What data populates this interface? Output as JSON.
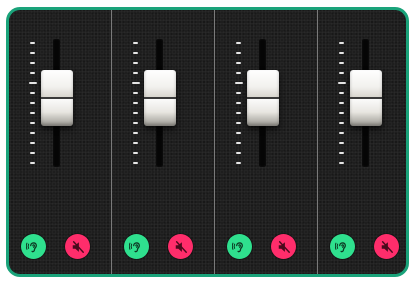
{
  "colors": {
    "frame_border": "#1aa37a",
    "panel_background": "#1e1e1e",
    "listen_button": "#2fe08e",
    "mute_button": "#ff2d6b",
    "tick_marks": "#e6e6e6"
  },
  "channels": [
    {
      "fader_level": 0.72,
      "listen_icon": "ear-icon",
      "mute_icon": "speaker-mute-icon"
    },
    {
      "fader_level": 0.72,
      "listen_icon": "ear-icon",
      "mute_icon": "speaker-mute-icon"
    },
    {
      "fader_level": 0.72,
      "listen_icon": "ear-icon",
      "mute_icon": "speaker-mute-icon"
    },
    {
      "fader_level": 0.72,
      "listen_icon": "ear-icon",
      "mute_icon": "speaker-mute-icon"
    }
  ]
}
